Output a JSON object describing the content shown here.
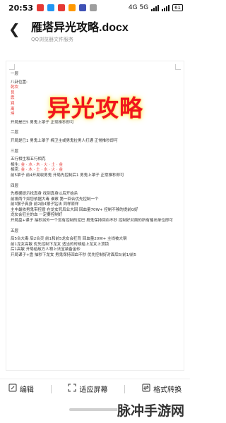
{
  "status_bar": {
    "time": "20:53",
    "network": "4G 5G",
    "battery": "61"
  },
  "header": {
    "title": "雁塔异光攻略.docx",
    "subtitle": "QQ浏览器文件服务"
  },
  "document": {
    "big_title": "异光攻略",
    "section1": {
      "heading": "一层",
      "label": "八卦位置:",
      "items": [
        "乾坎",
        "艮",
        "震",
        "巽",
        "离",
        "坤"
      ],
      "line": "开局是巳5 男鬼上罩子 正常推秒即可"
    },
    "section2": {
      "heading": "二层",
      "line": "开局是巳1 男鬼上罩子 棉卫主或男鬼拉男人打通 正常推秒即可"
    },
    "section3": {
      "heading": "三层",
      "title": "五行相生和五行相克",
      "sheng_label": "相生:",
      "sheng": "金 · 水 · 木 · 火 · 土 · 金",
      "ke_label": "相克:",
      "ke": "金 · 木 · 土 · 水 · 火 · 金",
      "line": "前5罩子 前4开局收男鬼 开局先控制后1 男鬼上罩子 正常推秒即可"
    },
    "section4": {
      "heading": "四层",
      "lines": [
        "先根据提示找真身 找到真身以后开始杀",
        "前排两个如您依据大毒 谁察 第一回合优先控制一个",
        "前3猴子真身 前2前4猴子钻法 同样原样",
        "主中最依男鬼带控盾 在龙女死后业大回 回血量70W+ 控制不够的提前G好",
        "龙女会狂主的血 一定要控制好",
        "开局盘+课子 抽秒另外一个没有控制的泥巴 男鬼保持回血不秒 控制好对面的所有输出单位即可"
      ]
    },
    "section5": {
      "heading": "五层",
      "lines": [
        "后5合大毒 后2合灵 前1和前5龙女会狂背 回血量20W+ 主线被大钢",
        "前1龙女高敏 优先控制下龙女 适当的时候给上龙女上顶锁",
        "后1高敏 开局给敌方人物上法宝装备金砂",
        "开局课子+盘 抽秒下龙女 男鬼保持回血不秒 优先控制好对面后5/前1/前5"
      ]
    }
  },
  "toolbar": {
    "edit_label": "编辑",
    "fit_label": "适应屏幕",
    "convert_label": "格式转换"
  },
  "watermark": "脉冲手游网"
}
